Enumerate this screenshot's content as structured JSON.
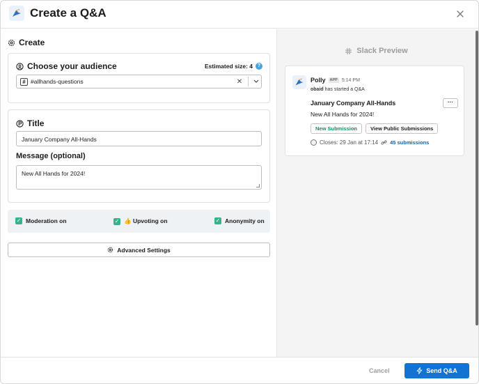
{
  "header": {
    "title": "Create a Q&A"
  },
  "create": {
    "section_title": "Create",
    "audience": {
      "heading": "Choose your audience",
      "estimated_label": "Estimated size: 4",
      "help_glyph": "?",
      "channel": "#allhands-questions"
    },
    "title_label": "Title",
    "title_value": "January Company All-Hands",
    "message_label": "Message (optional)",
    "message_value": "New All Hands for 2024!",
    "options": {
      "moderation": "Moderation on",
      "upvoting": "👍 Upvoting on",
      "anonymity": "Anonymity on"
    },
    "advanced_label": "Advanced Settings"
  },
  "preview": {
    "title": "Slack Preview",
    "bot_name": "Polly",
    "app_badge": "APP",
    "time": "5:14 PM",
    "started_user": "obaid",
    "started_text": "has started a Q&A",
    "qa_title": "January Company All-Hands",
    "qa_message": "New All Hands for 2024!",
    "more_label": "···",
    "new_submission": "New Submission",
    "view_public": "View Public Submissions",
    "closes": "Closes: 29 Jan at 17:14",
    "submissions": "45 submissions"
  },
  "footer": {
    "cancel": "Cancel",
    "send": "Send Q&A"
  },
  "colors": {
    "accent": "#1273d4",
    "check": "#37b28a",
    "link": "#1264a3"
  }
}
